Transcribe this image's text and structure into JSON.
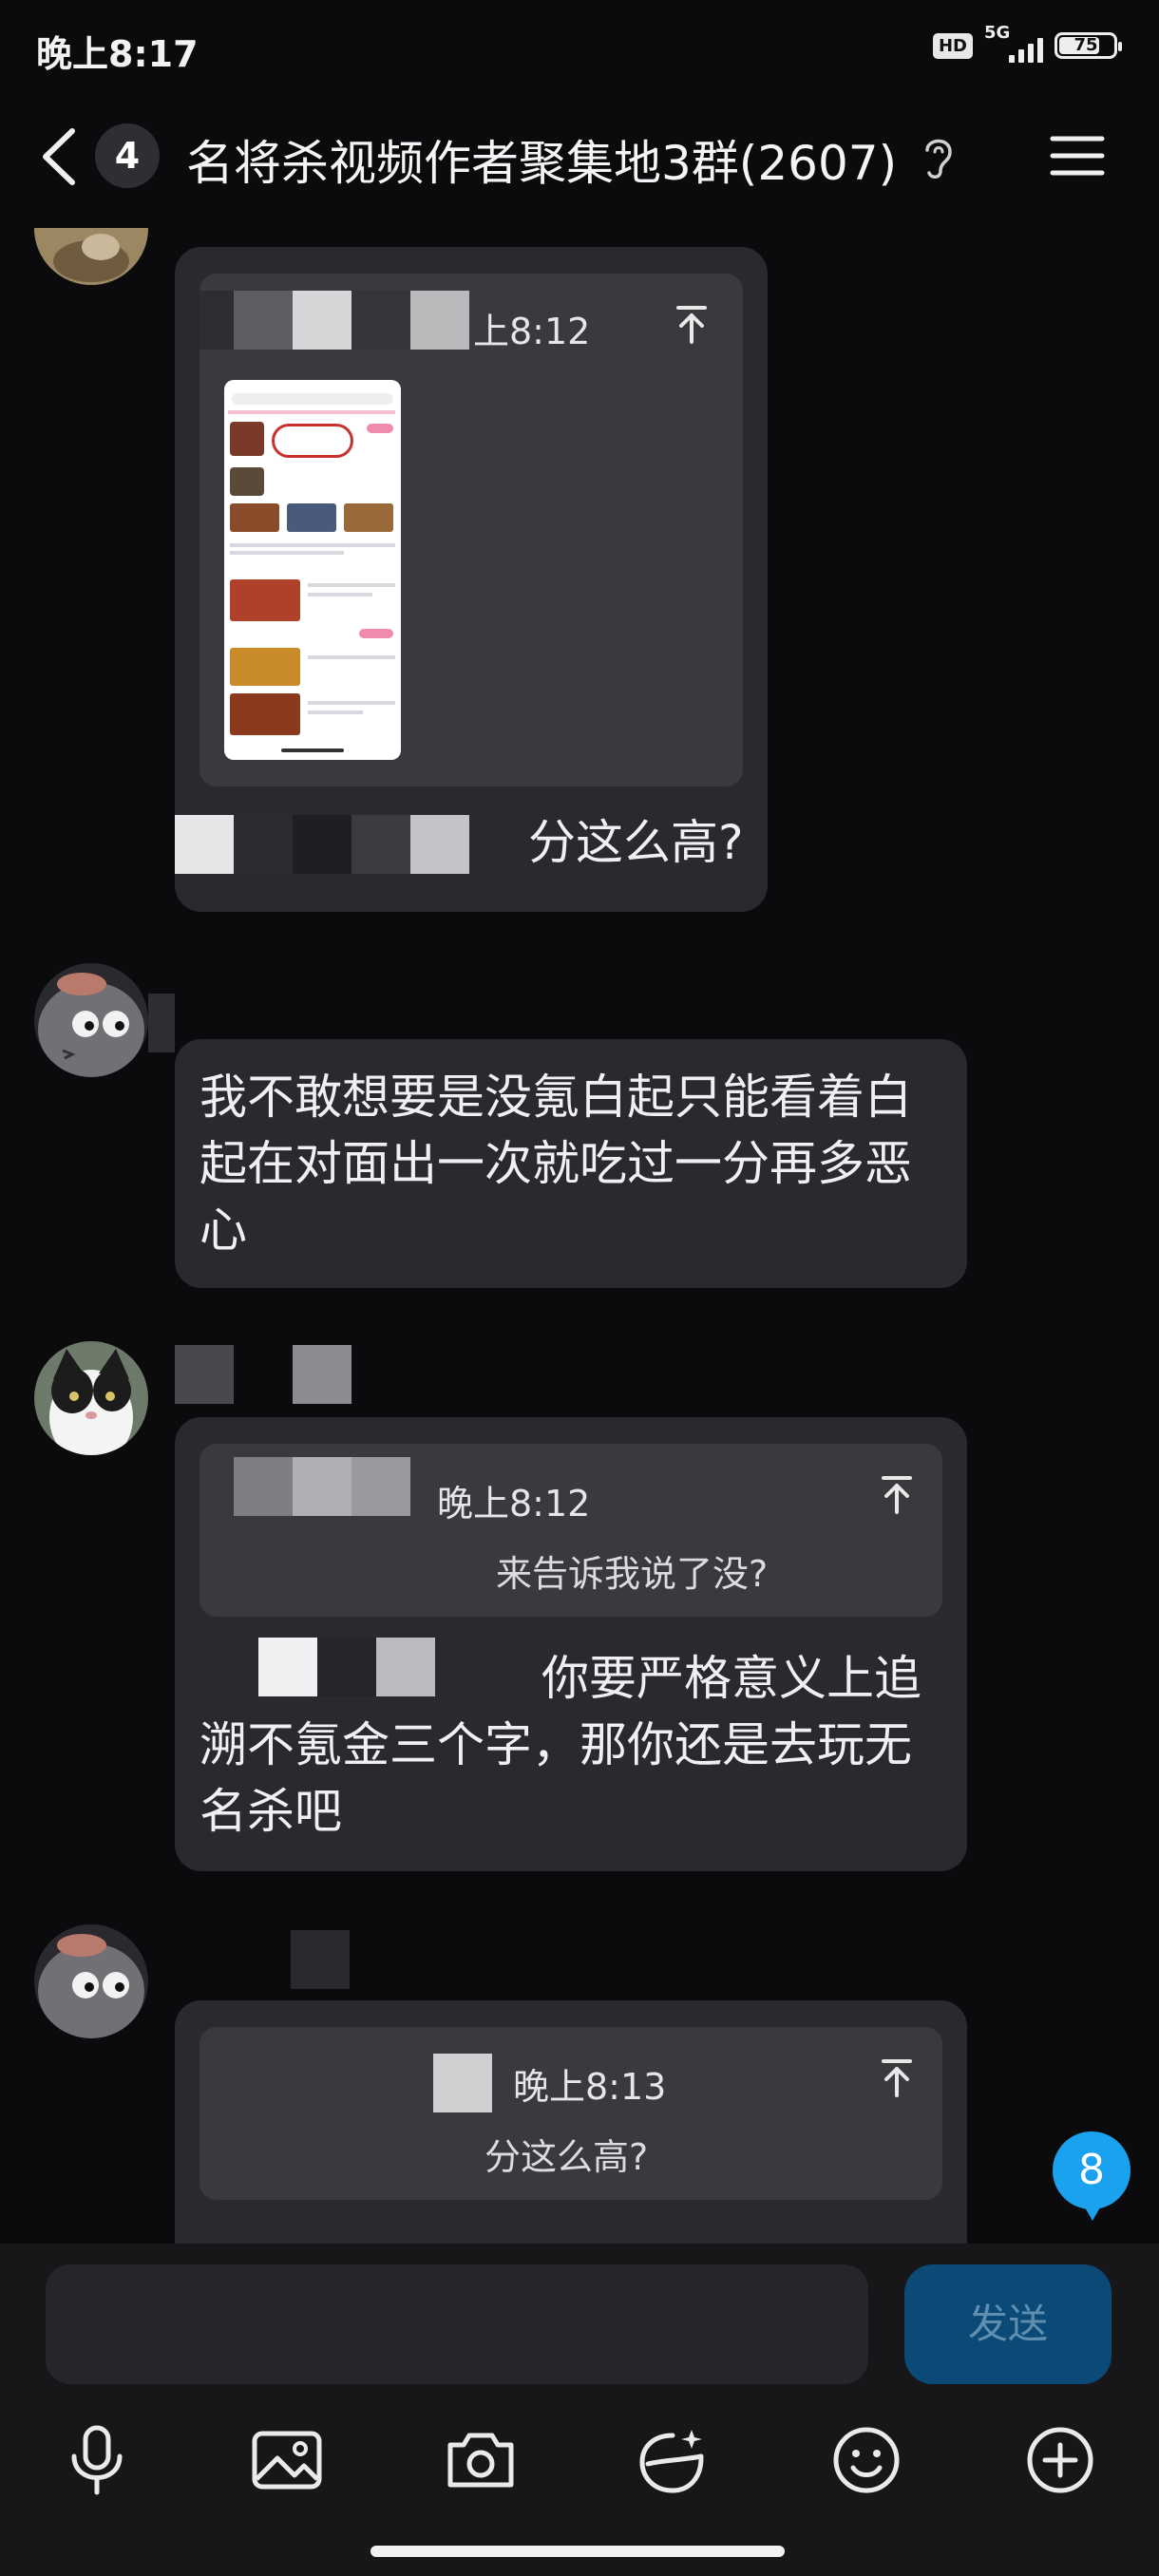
{
  "status_bar": {
    "time": "晚上8:17",
    "hd": "HD",
    "network": "5G",
    "battery": "75"
  },
  "header": {
    "unread_count": "4",
    "title": "名将杀视频作者聚集地3群(2607)"
  },
  "messages": [
    {
      "id": "m1",
      "quote_time": "上8:12",
      "text": "分这么高?"
    },
    {
      "id": "m2",
      "text": "我不敢想要是没氪白起只能看着白起在对面出一次就吃过一分再多恶心"
    },
    {
      "id": "m3",
      "quote_time": "晚上8:12",
      "quote_text": "来告诉我说了没?",
      "text": "你要严格意义上追溯不氪金三个字，那你还是去玩无名杀吧"
    },
    {
      "id": "m4",
      "quote_time": "晚上8:13",
      "quote_text": "分这么高?"
    }
  ],
  "new_message_badge": "8",
  "composer": {
    "placeholder": "",
    "send_label": "发送"
  },
  "toolbar_icons": [
    "microphone-icon",
    "image-icon",
    "camera-icon",
    "sticker-icon",
    "emoji-icon",
    "plus-icon"
  ],
  "colors": {
    "background": "#0b0b0e",
    "bubble": "#2a2a2e",
    "quote": "#3a3a3e",
    "badge": "#1aa2ee",
    "send": "#0b4a76"
  }
}
